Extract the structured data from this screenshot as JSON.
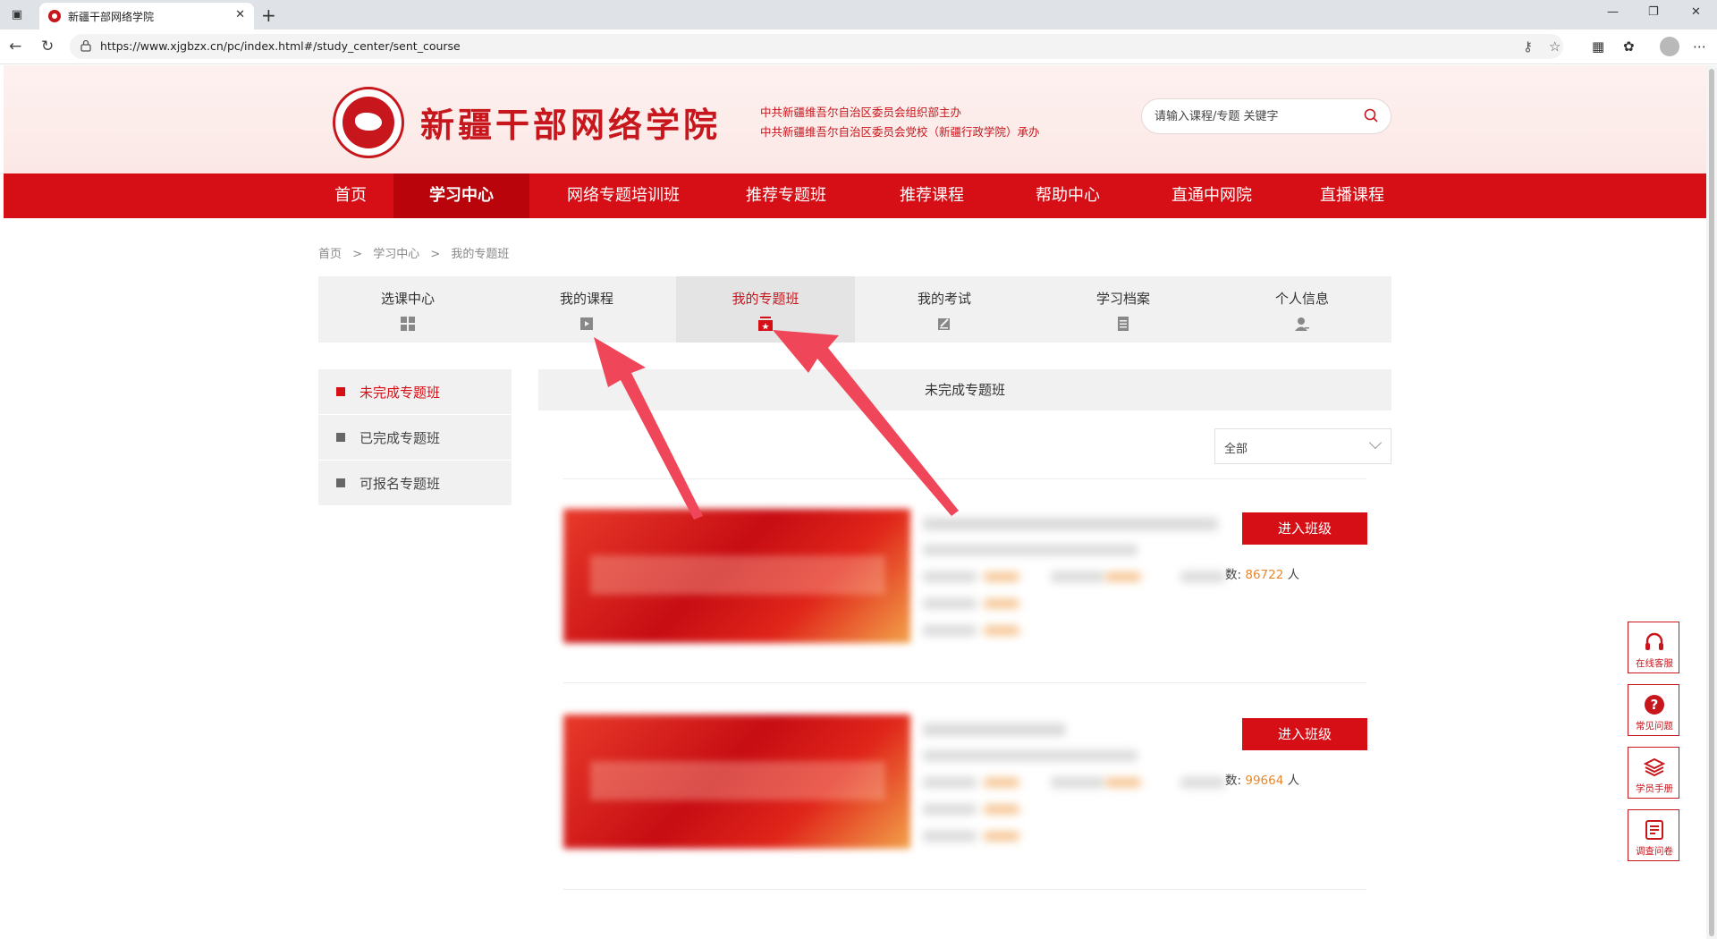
{
  "browser": {
    "tab_title": "新疆干部网络学院",
    "url": "https://www.xjgbzx.cn/pc/index.html#/study_center/sent_course"
  },
  "header": {
    "site_title": "新疆干部网络学院",
    "sponsor_line1": "中共新疆维吾尔自治区委员会组织部主办",
    "sponsor_line2": "中共新疆维吾尔自治区委员会党校（新疆行政学院）承办",
    "search_placeholder": "请输入课程/专题 关键字",
    "brand_color": "#d60f16"
  },
  "nav": {
    "items": [
      "首页",
      "学习中心",
      "网络专题培训班",
      "推荐专题班",
      "推荐课程",
      "帮助中心",
      "直通中网院",
      "直播课程"
    ],
    "active": "学习中心"
  },
  "breadcrumb": {
    "items": [
      "首页",
      "学习中心",
      "我的专题班"
    ],
    "separator": ">"
  },
  "center_tabs": {
    "items": [
      {
        "label": "选课中心",
        "icon": "grid-icon"
      },
      {
        "label": "我的课程",
        "icon": "video-icon"
      },
      {
        "label": "我的专题班",
        "icon": "flag-icon"
      },
      {
        "label": "我的考试",
        "icon": "exam-icon"
      },
      {
        "label": "学习档案",
        "icon": "document-icon"
      },
      {
        "label": "个人信息",
        "icon": "user-icon"
      }
    ],
    "active": "我的专题班"
  },
  "sidebar": {
    "items": [
      "未完成专题班",
      "已完成专题班",
      "可报名专题班"
    ],
    "active": "未完成专题班"
  },
  "panel": {
    "title": "未完成专题班",
    "filter_value": "全部"
  },
  "courses": [
    {
      "enroll_suffix": "数:",
      "enroll_count": "86722",
      "enroll_unit": "人",
      "button": "进入班级"
    },
    {
      "enroll_suffix": "数:",
      "enroll_count": "99664",
      "enroll_unit": "人",
      "button": "进入班级"
    }
  ],
  "float_tools": [
    {
      "label": "在线客服",
      "icon": "headset-icon"
    },
    {
      "label": "常见问题",
      "icon": "question-icon"
    },
    {
      "label": "学员手册",
      "icon": "book-icon"
    },
    {
      "label": "调查问卷",
      "icon": "survey-icon"
    }
  ]
}
